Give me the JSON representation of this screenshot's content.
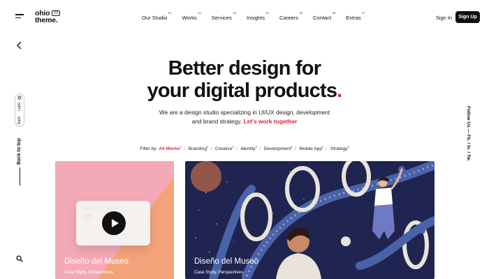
{
  "brand": {
    "logo_line1": "ohio",
    "logo_line2": "theme.",
    "version": "3.0"
  },
  "nav": {
    "items": [
      {
        "label": "Our Studio",
        "num": "01"
      },
      {
        "label": "Works",
        "num": "02"
      },
      {
        "label": "Services",
        "num": "03"
      },
      {
        "label": "Insights",
        "num": "04"
      },
      {
        "label": "Careers",
        "num": "05"
      },
      {
        "label": "Contact",
        "num": "06"
      },
      {
        "label": "Extras",
        "num": "07"
      }
    ],
    "signin": "Sign In",
    "signup": "Sign Up"
  },
  "sidebar": {
    "light": "Light",
    "dark": "Dark",
    "back_to_top": "Back to top"
  },
  "social": {
    "follow": "Follow Us — Fb. / In. / Tw."
  },
  "hero": {
    "title_line1": "Better design for",
    "title_line2": "your digital products",
    "title_dot": ".",
    "subtitle_line1": "We are a design studio specializing in UI/UX design, development",
    "subtitle_line2": "and brand strategy.",
    "cta": "Let's work together"
  },
  "filter": {
    "label": "Filter by",
    "items": [
      {
        "label": "All Works",
        "count": "1"
      },
      {
        "label": "Branding",
        "count": "2"
      },
      {
        "label": "Creative",
        "count": "2"
      },
      {
        "label": "Identity",
        "count": "2"
      },
      {
        "label": "Development",
        "count": "2"
      },
      {
        "label": "Mobile App",
        "count": "2"
      },
      {
        "label": "Strategy",
        "count": "2"
      }
    ]
  },
  "cards": [
    {
      "title": "Diseño del Museo",
      "meta": "Case Stydy, Perspectives",
      "card_text": "CREDIT CARD"
    },
    {
      "title": "Diseño del Museo",
      "meta": "Case Stydy, Perspectives"
    }
  ],
  "colors": {
    "accent": "#e0213b",
    "card1_bg": "#f4a9b6",
    "card1_orange": "#f3a37a",
    "card2_bg": "#1f2550"
  }
}
